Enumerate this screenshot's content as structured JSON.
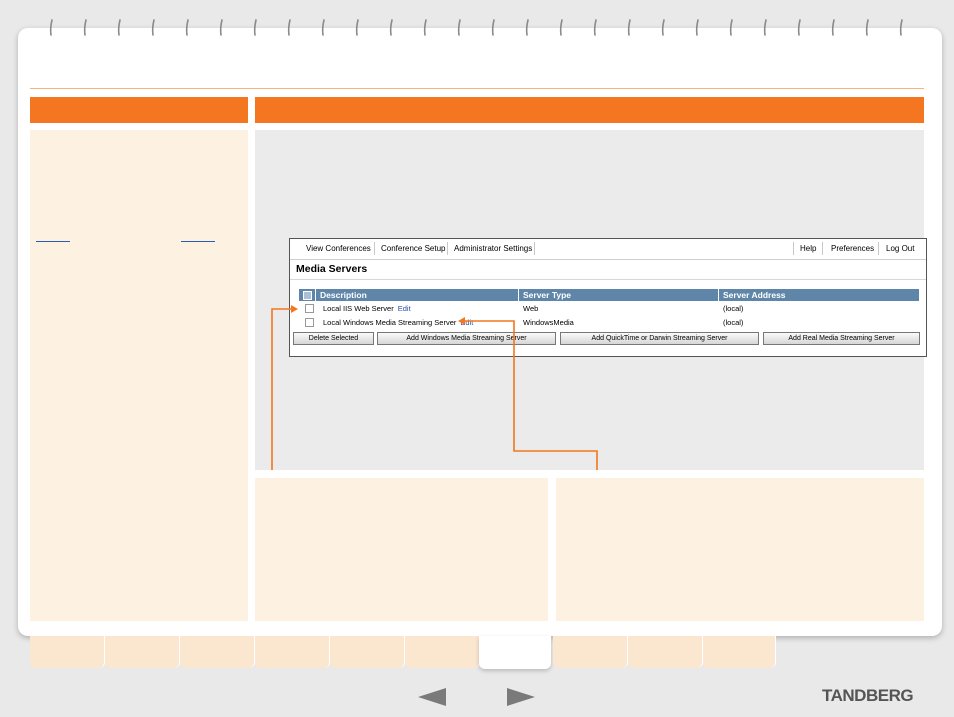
{
  "app": {
    "nav_left": [
      "View Conferences",
      "Conference Setup",
      "Administrator Settings"
    ],
    "nav_right": [
      "Help",
      "Preferences",
      "Log Out"
    ],
    "title": "Media Servers",
    "columns": [
      "Description",
      "Server Type",
      "Server Address"
    ],
    "rows": [
      {
        "description": "Local IIS Web Server",
        "edit": "Edit",
        "type": "Web",
        "address": "(local)"
      },
      {
        "description": "Local Windows Media Streaming Server",
        "edit": "Edit",
        "type": "WindowsMedia",
        "address": "(local)"
      }
    ],
    "buttons": [
      "Delete Selected",
      "Add Windows Media Streaming Server",
      "Add QuickTime or Darwin Streaming Server",
      "Add Real Media Streaming Server"
    ]
  },
  "brand": "TANDBERG",
  "prev_arrow": "◄",
  "next_arrow": "►",
  "colors": {
    "accent": "#f47620",
    "panel": "#fdf1e2",
    "table_header": "#5f86a8",
    "link": "#2b4fa8"
  }
}
